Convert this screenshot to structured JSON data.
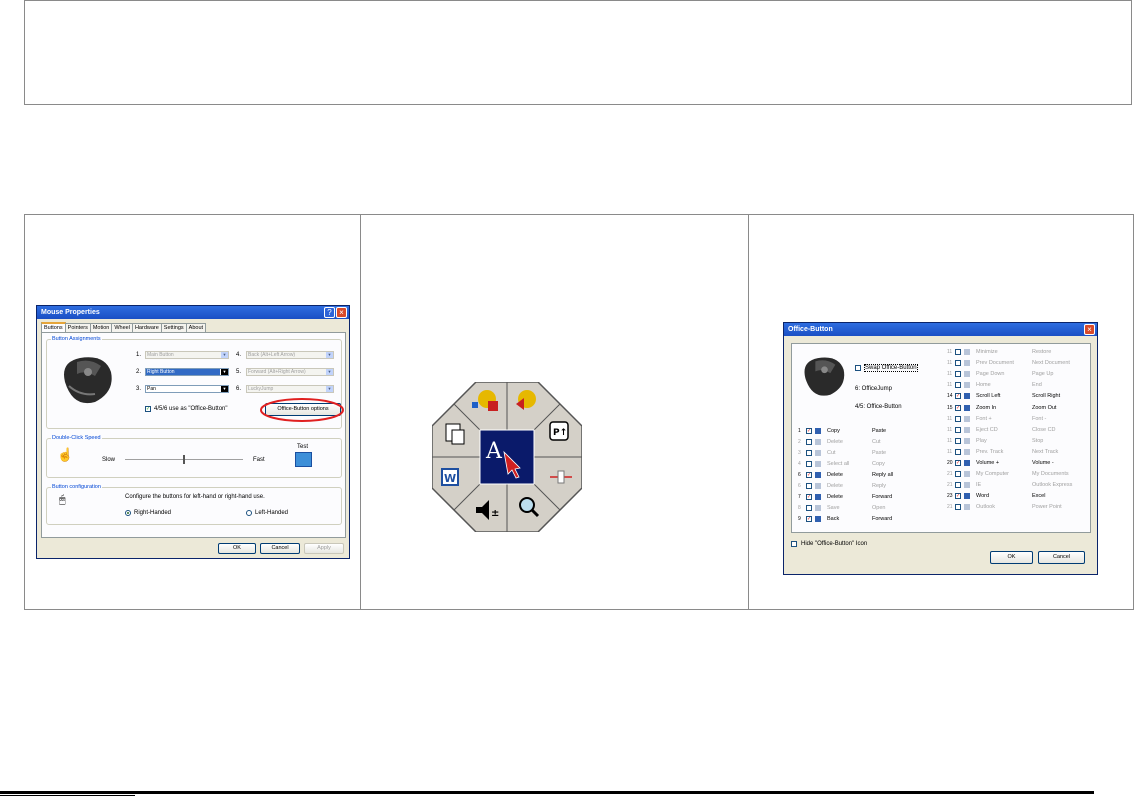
{
  "mouse_properties": {
    "title": "Mouse Properties",
    "help": "?",
    "close": "×",
    "tabs": [
      "Buttons",
      "Pointers",
      "Motion",
      "Wheel",
      "Hardware",
      "Settings",
      "About"
    ],
    "button_assignments": {
      "label": "Button Assignments",
      "rows": [
        {
          "n1": "1.",
          "v1": "Main Button",
          "n2": "4.",
          "v2": "Back (Alt+Left Arrow)"
        },
        {
          "n1": "2.",
          "v1": "Right Button",
          "n2": "5.",
          "v2": "Forward (Alt+Right Arrow)"
        },
        {
          "n1": "3.",
          "v1": "Pan",
          "n2": "6.",
          "v2": "LuckyJump"
        }
      ],
      "office_check": "4/5/6 use as \"Office-Button\"",
      "office_button": "Office-Button options"
    },
    "double_click": {
      "label": "Double-Click Speed",
      "slow": "Slow",
      "fast": "Fast",
      "test": "Test"
    },
    "config": {
      "label": "Button configuration",
      "desc": "Configure the buttons for left-hand or right-hand use.",
      "right": "Right-Handed",
      "left": "Left-Handed"
    },
    "ok": "OK",
    "cancel": "Cancel",
    "apply": "Apply"
  },
  "office_button": {
    "title": "Office-Button",
    "close": "×",
    "swap": "Swap Office-Button",
    "jump": "6: OfficeJump",
    "buttons45": "4/5: Office-Button",
    "left_items": [
      {
        "n": "1",
        "checked": true,
        "name": "Copy",
        "action": "Paste"
      },
      {
        "n": "2",
        "checked": false,
        "name": "Delete",
        "action": "Cut"
      },
      {
        "n": "3",
        "checked": false,
        "name": "Cut",
        "action": "Paste"
      },
      {
        "n": "4",
        "checked": false,
        "name": "Select all",
        "action": "Copy"
      },
      {
        "n": "6",
        "checked": true,
        "name": "Delete",
        "action": "Reply all"
      },
      {
        "n": "6",
        "checked": false,
        "name": "Delete",
        "action": "Reply"
      },
      {
        "n": "7",
        "checked": true,
        "name": "Delete",
        "action": "Forward"
      },
      {
        "n": "8",
        "checked": false,
        "name": "Save",
        "action": "Open"
      },
      {
        "n": "9",
        "checked": true,
        "name": "Back",
        "action": "Forward"
      }
    ],
    "right_items": [
      {
        "n": "11",
        "checked": false,
        "name": "Minimize",
        "action": "Restore"
      },
      {
        "n": "11",
        "checked": false,
        "name": "Prev Document",
        "action": "Next Document"
      },
      {
        "n": "11",
        "checked": false,
        "name": "Page Down",
        "action": "Page Up"
      },
      {
        "n": "11",
        "checked": false,
        "name": "Home",
        "action": "End"
      },
      {
        "n": "14",
        "checked": true,
        "name": "Scroll Left",
        "action": "Scroll Right"
      },
      {
        "n": "15",
        "checked": true,
        "name": "Zoom In",
        "action": "Zoom Out"
      },
      {
        "n": "11",
        "checked": false,
        "name": "Font +",
        "action": "Font -"
      },
      {
        "n": "11",
        "checked": false,
        "name": "Eject CD",
        "action": "Close CD"
      },
      {
        "n": "11",
        "checked": false,
        "name": "Play",
        "action": "Stop"
      },
      {
        "n": "11",
        "checked": false,
        "name": "Prev. Track",
        "action": "Next Track"
      },
      {
        "n": "20",
        "checked": true,
        "name": "Volume +",
        "action": "Volume -"
      },
      {
        "n": "21",
        "checked": false,
        "name": "My Computer",
        "action": "My Documents"
      },
      {
        "n": "21",
        "checked": false,
        "name": "IE",
        "action": "Outlook Express"
      },
      {
        "n": "23",
        "checked": true,
        "name": "Word",
        "action": "Excel"
      },
      {
        "n": "21",
        "checked": false,
        "name": "Outlook",
        "action": "Power Point"
      }
    ],
    "hide_icon": "Hide \"Office-Button\" Icon",
    "ok": "OK",
    "cancel": "Cancel"
  }
}
